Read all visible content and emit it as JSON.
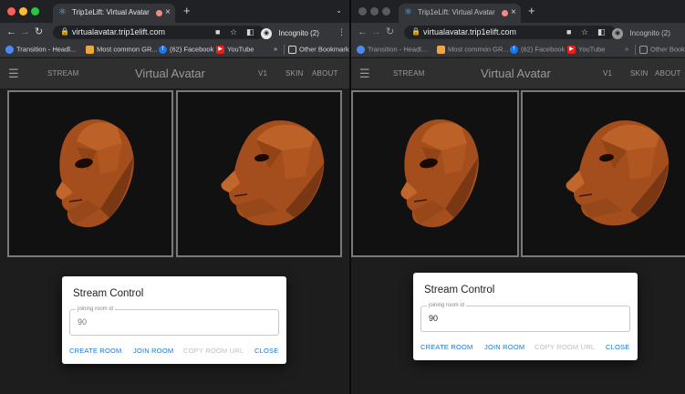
{
  "colors": {
    "accent": "#1976d2",
    "disabled": "#bdbdbd",
    "traffic_red": "#ff5f57",
    "traffic_yellow": "#febc2e",
    "traffic_green": "#28c840",
    "face_base": "#a54e1d",
    "face_light": "#c2672b",
    "face_dark": "#6e3212"
  },
  "left": {
    "tab": {
      "favicon": "atom-icon",
      "title": "Trip1eLift: Virtual Avatar",
      "close": "×"
    },
    "newtab": "+",
    "tabmenu": "⌄",
    "url": "virtualavatar.trip1elift.com",
    "incognito": "Incognito (2)",
    "bookmarks": [
      {
        "label": "Transition - Headl...",
        "icon": "#4c8bf5",
        "glyph": ""
      },
      {
        "label": "Most common GR...",
        "icon": "#f0a640",
        "glyph": ""
      },
      {
        "label": "(62) Facebook",
        "icon": "#1877f2",
        "glyph": "f"
      },
      {
        "label": "YouTube",
        "icon": "#e62117",
        "glyph": "▶"
      }
    ],
    "overflow": "»",
    "other_bookmarks": "Other Bookmarks",
    "nav_stream": "STREAM",
    "app_title": "Virtual Avatar",
    "nav_v1": "V1",
    "nav_skin": "SKIN",
    "nav_about": "ABOUT",
    "modal": {
      "title": "Stream Control",
      "field_label": "joining room id",
      "field_value": "",
      "field_placeholder": "90",
      "create": "CREATE ROOM",
      "join": "JOIN ROOM",
      "copy": "COPY ROOM URL",
      "close": "CLOSE"
    }
  },
  "right": {
    "tab": {
      "favicon": "atom-icon",
      "title": "Trip1eLift: Virtual Avatar",
      "close": "×"
    },
    "newtab": "+",
    "url": "virtualavatar.trip1elift.com",
    "incognito": "Incognito (2)",
    "bookmarks": [
      {
        "label": "Transition - Headl...",
        "icon": "#4c8bf5",
        "glyph": ""
      },
      {
        "label": "Most common GR...",
        "icon": "#f0a640",
        "glyph": ""
      },
      {
        "label": "(62) Facebook",
        "icon": "#1877f2",
        "glyph": "f"
      },
      {
        "label": "YouTube",
        "icon": "#e62117",
        "glyph": "▶"
      }
    ],
    "overflow": "»",
    "other_bookmarks": "Other Bookmark",
    "nav_stream": "STREAM",
    "app_title": "Virtual Avatar",
    "nav_v1": "V1",
    "nav_skin": "SKIN",
    "nav_about": "ABOUT",
    "modal": {
      "title": "Stream Control",
      "field_label": "joining room id",
      "field_value": "90",
      "field_placeholder": "",
      "create": "CREATE ROOM",
      "join": "JOIN ROOM",
      "copy": "COPY ROOM URL",
      "close": "CLOSE"
    }
  }
}
